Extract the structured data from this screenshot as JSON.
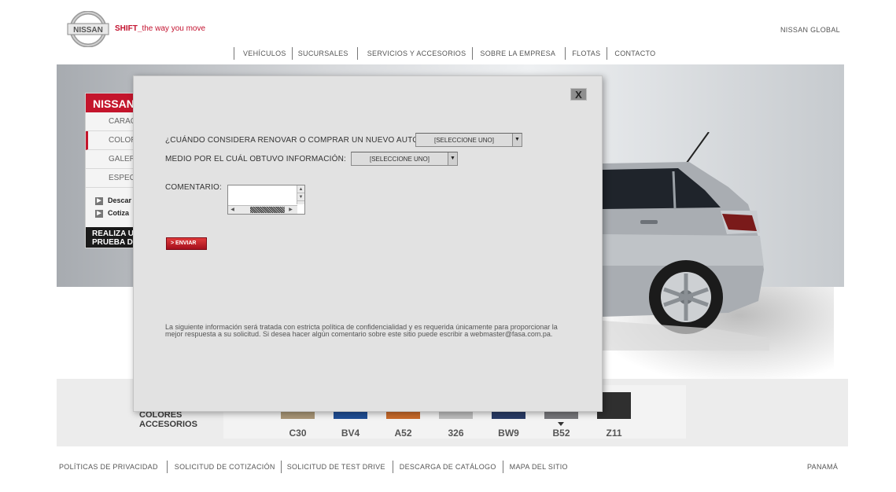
{
  "header": {
    "logo_text": "NISSAN",
    "tagline_bold": "SHIFT_",
    "tagline_rest": "the way you move",
    "global_link": "NISSAN GLOBAL"
  },
  "nav": {
    "items": [
      "VEHÍCULOS",
      "SUCURSALES",
      "SERVICIOS Y ACCESORIOS",
      "SOBRE LA EMPRESA",
      "FLOTAS",
      "CONTACTO"
    ]
  },
  "side_menu": {
    "title": "NISSAN",
    "items": [
      "CARAC",
      "COLOR",
      "GALER",
      "ESPEC"
    ],
    "links": [
      "Descar",
      "Cotiza"
    ],
    "cta_line1": "REALIZA U",
    "cta_line2": "PRUEBA D"
  },
  "colors": {
    "tabs": [
      "COLORES",
      "ACCESORIOS"
    ],
    "swatches": [
      {
        "code": "C30",
        "color": "#a99676"
      },
      {
        "code": "BV4",
        "color": "#1f4e95"
      },
      {
        "code": "A52",
        "color": "#c86a2a"
      },
      {
        "code": "326",
        "color": "#bdbdbd"
      },
      {
        "code": "BW9",
        "color": "#293b66"
      },
      {
        "code": "B52",
        "color": "#76767a"
      },
      {
        "code": "Z11",
        "color": "#2f2f2f"
      }
    ],
    "selected": "B52"
  },
  "modal": {
    "close_label": "X",
    "question1": "¿CUÁNDO CONSIDERA RENOVAR O COMPRAR UN NUEVO AUTO?:",
    "select1_value": "[SELECCIONE UNO]",
    "question2": "MEDIO POR EL CUÁL OBTUVO INFORMACIÓN:",
    "select2_value": "[SELECCIONE UNO]",
    "comment_label": "COMENTARIO:",
    "comment_value": "",
    "send_label": "> ENVIAR",
    "privacy_text": "La siguiente información será tratada con estricta política de confidencialidad y es requerida únicamente para proporcionar la mejor respuesta a su solicitud.  Si desea hacer algún comentario sobre este sitio puede escribir a webmaster@fasa.com.pa."
  },
  "footer": {
    "links": [
      "POLÍTICAS DE PRIVACIDAD",
      "SOLICITUD DE COTIZACIÓN",
      "SOLICITUD DE TEST DRIVE",
      "DESCARGA DE CATÁLOGO",
      "MAPA DEL SITIO"
    ],
    "country": "PANAMÁ"
  },
  "theme": {
    "brand_red": "#c3122f",
    "modal_bg": "#e2e2e2"
  }
}
